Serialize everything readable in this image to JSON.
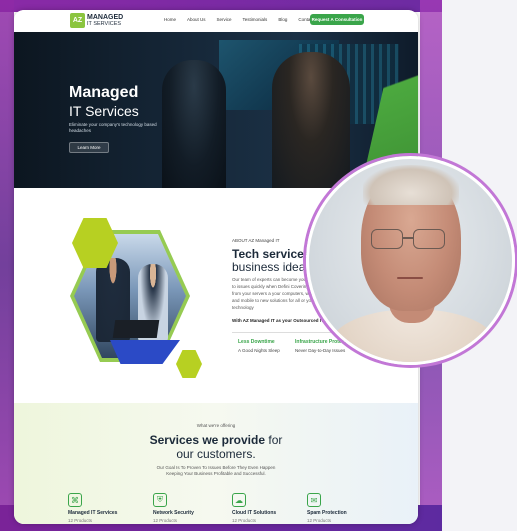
{
  "colors": {
    "accent": "#3aa54a",
    "lime": "#b7d022",
    "purple": "#9a34b3",
    "dark": "#1c2a3a"
  },
  "nav": {
    "logo_mark": "AZ",
    "logo_line1": "MANAGED",
    "logo_line2": "IT SERVICES",
    "links": [
      "Home",
      "About Us",
      "Service",
      "Testimonials",
      "Blog",
      "Contact Us"
    ],
    "cta": "Request A Consultation"
  },
  "hero": {
    "title_line1": "Managed",
    "title_line2": "IT Services",
    "subtitle": "Eliminate your company's technology based headaches",
    "button": "Learn More"
  },
  "about": {
    "kicker": "ABOUT AZ Managed IT",
    "heading_line1": "Tech services",
    "heading_line2": "business idea",
    "paragraph": "Our team of experts can become your responding to issues quickly when Defini Covering everything from your servers a your computers, workstations and mobile to new solutions for all or your technology",
    "cta": "With AZ Managed IT as your Outsourced IT provid",
    "features": [
      {
        "title": "Less Downtime",
        "subtitle": "A Good Nights Sleep"
      },
      {
        "title": "Infrastructure Protect",
        "subtitle": "Never Day-to-Day Issues"
      }
    ]
  },
  "services": {
    "kicker": "What we're offering",
    "heading_bold": "Services we provide",
    "heading_rest": " for",
    "heading_line2": "our customers.",
    "paragraph": "Our Goal Is To Proven To Issues Before They Even Happen Keeping Your Business Profitable and Successful.",
    "cards": [
      {
        "name": "Managed IT Services",
        "count": "12 Products",
        "icon": "network-icon"
      },
      {
        "name": "Network Security",
        "count": "12 Products",
        "icon": "shield-network-icon"
      },
      {
        "name": "Cloud IT Solutions",
        "count": "12 Products",
        "icon": "cloud-icon"
      },
      {
        "name": "Spam Protection",
        "count": "12 Products",
        "icon": "mail-shield-icon"
      }
    ]
  }
}
